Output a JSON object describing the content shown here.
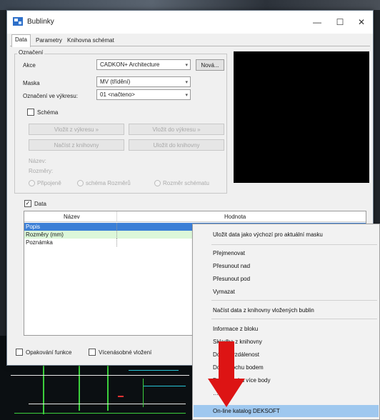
{
  "window": {
    "title": "Bublinky",
    "controls": {
      "minimize": "—",
      "maximize": "☐",
      "close": "✕"
    }
  },
  "tabs": [
    "Data",
    "Parametry",
    "Knihovna schémat"
  ],
  "designation": {
    "group_label": "Označení",
    "rows": [
      {
        "label": "Akce",
        "value": "CADKON+ Architecture"
      },
      {
        "label": "Maska",
        "value": "MV (třídění)"
      },
      {
        "label": "Označení ve výkresu:",
        "value": "01 <načteno>"
      }
    ],
    "new_button": "Nová...",
    "schema_label": "Schéma",
    "schema_buttons": [
      "Vložit z výkresu »",
      "Vložit do výkresu »",
      "Načíst z knihovny",
      "Uložit do knihovny"
    ],
    "disabled_labels": [
      "Název:",
      "Rozměry:"
    ],
    "radios": [
      "Připojeně",
      "schéma Rozměrů",
      "Rozměr schématu"
    ]
  },
  "data_section": {
    "checkbox_label": "Data",
    "checked_mark": "✓",
    "columns": [
      "Název",
      "Hodnota"
    ],
    "rows": [
      "Popis",
      "Rozměry (mm)",
      "Poznámka"
    ]
  },
  "bottom": {
    "repeat_label": "Opakování funkce",
    "multi_label": "Vícenásobné vložení"
  },
  "context_menu": {
    "items": [
      "Uložit data jako výchozí pro aktuální masku",
      "Přejmenovat",
      "Přesunout nad",
      "Přesunout pod",
      "Vymazat",
      "Načíst data z knihovny vložených bublin",
      "Informace z bloku",
      "Skladba z knihovny",
      "Do… z vzdálenost",
      "Do… plochu bodem",
      "Do… plochu více body",
      "…bulka",
      "On-line katalog DEKSOFT"
    ],
    "highlighted_index": 12
  },
  "colors": {
    "selection_blue": "#3c7fd6",
    "row_green": "#dcf7d9",
    "menu_highlight": "#9fc8ef",
    "arrow_red": "#dd1414"
  }
}
